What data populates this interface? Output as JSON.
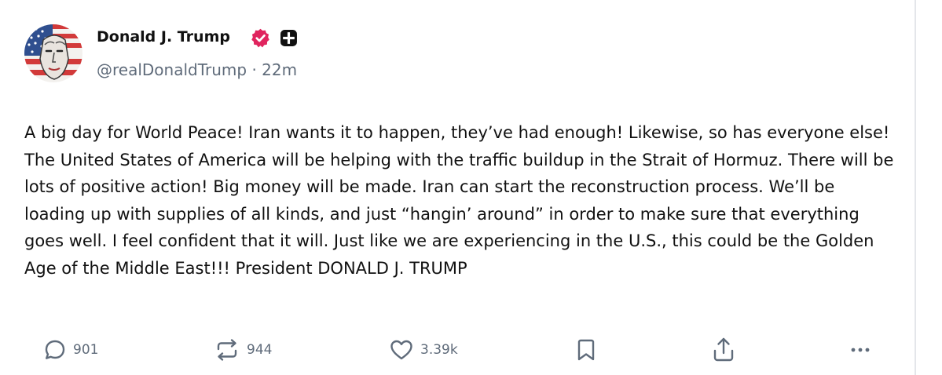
{
  "post": {
    "author": {
      "display_name": "Donald J. Trump",
      "handle": "@realDonaldTrump",
      "separator": "·",
      "time_ago": "22m",
      "avatar_icon": "flag-portrait-avatar",
      "verified_icon": "verified-badge-icon",
      "badge_icon": "plus-badge-icon"
    },
    "text": "A big day for World Peace! Iran wants it to happen, they’ve had enough! Likewise, so has everyone else! The United States of America will be helping with the traffic buildup in the Strait of Hormuz. There will be lots of positive action! Big money will be made. Iran can start the reconstruction process. We’ll be loading up with supplies of all kinds, and just “hangin’ around” in order to make sure that everything goes well. I feel confident that it will. Just like we are experiencing in the U.S., this could be the Golden Age of the Middle East!!! President DONALD J. TRUMP",
    "actions": {
      "reply_count": "901",
      "repost_count": "944",
      "like_count": "3.39k"
    }
  },
  "colors": {
    "text": "#111111",
    "muted": "#5f6b7a",
    "verified": "#e0245e",
    "badge": "#111111",
    "border": "#e4e6ea"
  }
}
